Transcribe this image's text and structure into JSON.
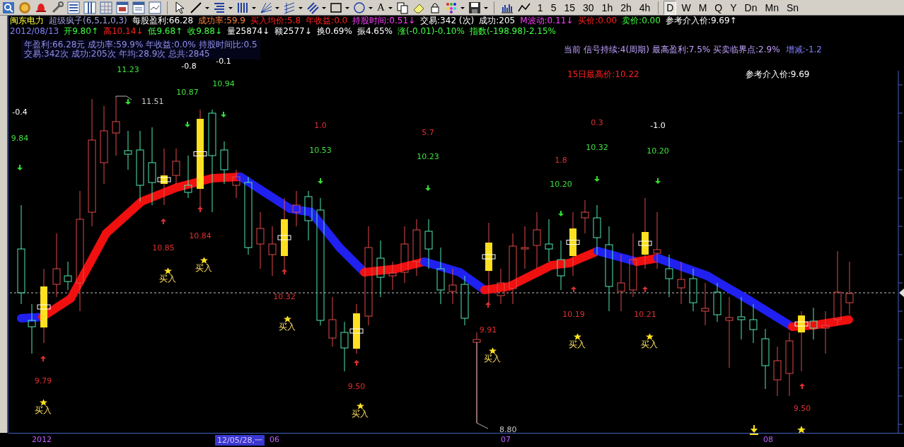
{
  "toolbar": {
    "text_tool": "A",
    "periods": [
      {
        "label": "1",
        "selected": false
      },
      {
        "label": "5",
        "selected": false
      },
      {
        "label": "15",
        "selected": false
      },
      {
        "label": "30",
        "selected": false
      },
      {
        "label": "1h",
        "selected": false
      },
      {
        "label": "2h",
        "selected": false
      },
      {
        "label": "4h",
        "selected": false
      },
      {
        "label": "D",
        "selected": true
      },
      {
        "label": "W",
        "selected": false
      },
      {
        "label": "M",
        "selected": false
      },
      {
        "label": "Q",
        "selected": false
      },
      {
        "label": "Y",
        "selected": false
      },
      {
        "label": "Dn",
        "selected": false
      },
      {
        "label": "Mn",
        "selected": false
      },
      {
        "label": "Sn",
        "selected": false
      }
    ]
  },
  "quote_line": [
    {
      "text": "闽东电力",
      "color": "#ffff40"
    },
    {
      "text": "超级疯子(6,5,1,0,3)",
      "color": "#a0a0e0"
    },
    {
      "text": "每股盈利:66.28",
      "color": "#ffffff"
    },
    {
      "text": "成功率:59.9",
      "color": "#ff8040"
    },
    {
      "text": "买入均价:5.8",
      "color": "#ff2020"
    },
    {
      "text": "年收益:0.0",
      "color": "#ff2020"
    },
    {
      "text": "持股时间:0.51↓",
      "color": "#ff40ff"
    },
    {
      "text": "交易:342 (次)",
      "color": "#ffffff"
    },
    {
      "text": "成功:205",
      "color": "#ffffff"
    },
    {
      "text": "M波动:0.11↓",
      "color": "#ff40ff"
    },
    {
      "text": "买价:0.00",
      "color": "#ff2020"
    },
    {
      "text": "卖价:0.00",
      "color": "#40ff40"
    },
    {
      "text": "参考介入价:9.69↑",
      "color": "#ffffff"
    }
  ],
  "price_line": [
    {
      "text": "2012/08/13",
      "color": "#8080ff"
    },
    {
      "text": "开9.80↑",
      "color": "#40ff40"
    },
    {
      "text": "高10.14↓",
      "color": "#ff2020"
    },
    {
      "text": "低9.68↑",
      "color": "#40ff40"
    },
    {
      "text": "收9.88↓",
      "color": "#40ff40"
    },
    {
      "text": "量25874↓",
      "color": "#ffffff"
    },
    {
      "text": "额2577↓",
      "color": "#ffffff"
    },
    {
      "text": "换0.69%",
      "color": "#ffffff"
    },
    {
      "text": "振4.65%",
      "color": "#ffffff"
    },
    {
      "text": "涨(-0.01)-0.10%",
      "color": "#40ff40"
    },
    {
      "text": "指数(-198.98)-2.15%",
      "color": "#40ff40"
    }
  ],
  "stats_box": {
    "lines": [
      "年盈利:66.28元 成功率:59.9% 年收益:0.0% 持股时间比:0.5",
      "交易:342次 成功:205次 年均:28.9次 总共:2845"
    ]
  },
  "signal_panel": {
    "rows": [
      [
        {
          "text": "当前 信号持续:4(周期) 最高盈利:7.5% 买卖临界点:2.9%",
          "color": "#c0a0ff"
        },
        {
          "text": "增减:-1.2",
          "color": "#8080ff"
        }
      ],
      [
        {
          "text": "15日最高价:10.22",
          "color": "#ff2020"
        },
        {
          "text": "参考介入价:9.69",
          "color": "#ffffff"
        }
      ]
    ]
  },
  "chart": {
    "labels": [
      {
        "kind": "change_down",
        "text": "-0.4"
      },
      {
        "kind": "high",
        "text": "9.84"
      },
      {
        "kind": "low",
        "text": "9.79"
      },
      {
        "kind": "buy",
        "text": "买入"
      },
      {
        "kind": "high",
        "text": "11.23"
      },
      {
        "kind": "extreme",
        "text": "11.51"
      },
      {
        "kind": "low",
        "text": "10.85"
      },
      {
        "kind": "buy",
        "text": "买入"
      },
      {
        "kind": "change_down",
        "text": "-0.8"
      },
      {
        "kind": "high",
        "text": "10.87"
      },
      {
        "kind": "low",
        "text": "10.84"
      },
      {
        "kind": "buy",
        "text": "买入"
      },
      {
        "kind": "change_down",
        "text": "-0.1"
      },
      {
        "kind": "high",
        "text": "10.94"
      },
      {
        "kind": "low",
        "text": "10.32"
      },
      {
        "kind": "buy",
        "text": "买入"
      },
      {
        "kind": "change_up",
        "text": "1.0"
      },
      {
        "kind": "high",
        "text": "10.53"
      },
      {
        "kind": "low",
        "text": "9.50"
      },
      {
        "kind": "buy",
        "text": "买入"
      },
      {
        "kind": "change_up",
        "text": "5.7"
      },
      {
        "kind": "high",
        "text": "10.23"
      },
      {
        "kind": "low",
        "text": "9.91"
      },
      {
        "kind": "buy",
        "text": "买入"
      },
      {
        "kind": "extreme",
        "text": "8.80"
      },
      {
        "kind": "change_up",
        "text": "1.8"
      },
      {
        "kind": "high",
        "text": "10.20"
      },
      {
        "kind": "low",
        "text": "10.19"
      },
      {
        "kind": "buy",
        "text": "买入"
      },
      {
        "kind": "change_up",
        "text": "0.3"
      },
      {
        "kind": "high",
        "text": "10.32"
      },
      {
        "kind": "change_down",
        "text": "-1.0"
      },
      {
        "kind": "high",
        "text": "10.20"
      },
      {
        "kind": "low",
        "text": "10.21"
      },
      {
        "kind": "buy",
        "text": "买入"
      },
      {
        "kind": "low",
        "text": "9.50"
      }
    ],
    "axis_labels": [
      {
        "text": "2012",
        "selected": false
      },
      {
        "text": "12/05/28,一",
        "selected": true
      },
      {
        "text": "06",
        "selected": false
      },
      {
        "text": "07",
        "selected": false
      },
      {
        "text": "08",
        "selected": false
      }
    ]
  }
}
